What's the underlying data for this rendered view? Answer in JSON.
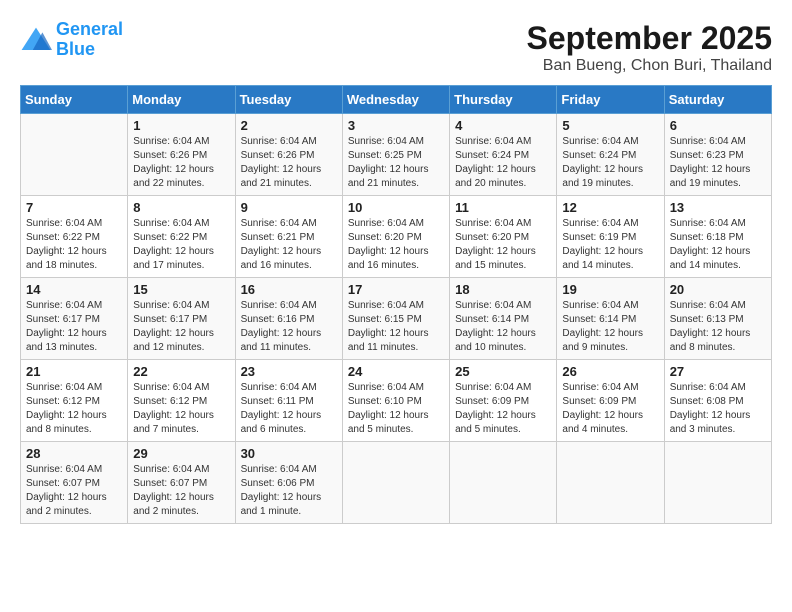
{
  "header": {
    "logo_line1": "General",
    "logo_line2": "Blue",
    "month": "September 2025",
    "location": "Ban Bueng, Chon Buri, Thailand"
  },
  "days_of_week": [
    "Sunday",
    "Monday",
    "Tuesday",
    "Wednesday",
    "Thursday",
    "Friday",
    "Saturday"
  ],
  "weeks": [
    [
      {
        "day": "",
        "info": ""
      },
      {
        "day": "1",
        "info": "Sunrise: 6:04 AM\nSunset: 6:26 PM\nDaylight: 12 hours\nand 22 minutes."
      },
      {
        "day": "2",
        "info": "Sunrise: 6:04 AM\nSunset: 6:26 PM\nDaylight: 12 hours\nand 21 minutes."
      },
      {
        "day": "3",
        "info": "Sunrise: 6:04 AM\nSunset: 6:25 PM\nDaylight: 12 hours\nand 21 minutes."
      },
      {
        "day": "4",
        "info": "Sunrise: 6:04 AM\nSunset: 6:24 PM\nDaylight: 12 hours\nand 20 minutes."
      },
      {
        "day": "5",
        "info": "Sunrise: 6:04 AM\nSunset: 6:24 PM\nDaylight: 12 hours\nand 19 minutes."
      },
      {
        "day": "6",
        "info": "Sunrise: 6:04 AM\nSunset: 6:23 PM\nDaylight: 12 hours\nand 19 minutes."
      }
    ],
    [
      {
        "day": "7",
        "info": "Sunrise: 6:04 AM\nSunset: 6:22 PM\nDaylight: 12 hours\nand 18 minutes."
      },
      {
        "day": "8",
        "info": "Sunrise: 6:04 AM\nSunset: 6:22 PM\nDaylight: 12 hours\nand 17 minutes."
      },
      {
        "day": "9",
        "info": "Sunrise: 6:04 AM\nSunset: 6:21 PM\nDaylight: 12 hours\nand 16 minutes."
      },
      {
        "day": "10",
        "info": "Sunrise: 6:04 AM\nSunset: 6:20 PM\nDaylight: 12 hours\nand 16 minutes."
      },
      {
        "day": "11",
        "info": "Sunrise: 6:04 AM\nSunset: 6:20 PM\nDaylight: 12 hours\nand 15 minutes."
      },
      {
        "day": "12",
        "info": "Sunrise: 6:04 AM\nSunset: 6:19 PM\nDaylight: 12 hours\nand 14 minutes."
      },
      {
        "day": "13",
        "info": "Sunrise: 6:04 AM\nSunset: 6:18 PM\nDaylight: 12 hours\nand 14 minutes."
      }
    ],
    [
      {
        "day": "14",
        "info": "Sunrise: 6:04 AM\nSunset: 6:17 PM\nDaylight: 12 hours\nand 13 minutes."
      },
      {
        "day": "15",
        "info": "Sunrise: 6:04 AM\nSunset: 6:17 PM\nDaylight: 12 hours\nand 12 minutes."
      },
      {
        "day": "16",
        "info": "Sunrise: 6:04 AM\nSunset: 6:16 PM\nDaylight: 12 hours\nand 11 minutes."
      },
      {
        "day": "17",
        "info": "Sunrise: 6:04 AM\nSunset: 6:15 PM\nDaylight: 12 hours\nand 11 minutes."
      },
      {
        "day": "18",
        "info": "Sunrise: 6:04 AM\nSunset: 6:14 PM\nDaylight: 12 hours\nand 10 minutes."
      },
      {
        "day": "19",
        "info": "Sunrise: 6:04 AM\nSunset: 6:14 PM\nDaylight: 12 hours\nand 9 minutes."
      },
      {
        "day": "20",
        "info": "Sunrise: 6:04 AM\nSunset: 6:13 PM\nDaylight: 12 hours\nand 8 minutes."
      }
    ],
    [
      {
        "day": "21",
        "info": "Sunrise: 6:04 AM\nSunset: 6:12 PM\nDaylight: 12 hours\nand 8 minutes."
      },
      {
        "day": "22",
        "info": "Sunrise: 6:04 AM\nSunset: 6:12 PM\nDaylight: 12 hours\nand 7 minutes."
      },
      {
        "day": "23",
        "info": "Sunrise: 6:04 AM\nSunset: 6:11 PM\nDaylight: 12 hours\nand 6 minutes."
      },
      {
        "day": "24",
        "info": "Sunrise: 6:04 AM\nSunset: 6:10 PM\nDaylight: 12 hours\nand 5 minutes."
      },
      {
        "day": "25",
        "info": "Sunrise: 6:04 AM\nSunset: 6:09 PM\nDaylight: 12 hours\nand 5 minutes."
      },
      {
        "day": "26",
        "info": "Sunrise: 6:04 AM\nSunset: 6:09 PM\nDaylight: 12 hours\nand 4 minutes."
      },
      {
        "day": "27",
        "info": "Sunrise: 6:04 AM\nSunset: 6:08 PM\nDaylight: 12 hours\nand 3 minutes."
      }
    ],
    [
      {
        "day": "28",
        "info": "Sunrise: 6:04 AM\nSunset: 6:07 PM\nDaylight: 12 hours\nand 2 minutes."
      },
      {
        "day": "29",
        "info": "Sunrise: 6:04 AM\nSunset: 6:07 PM\nDaylight: 12 hours\nand 2 minutes."
      },
      {
        "day": "30",
        "info": "Sunrise: 6:04 AM\nSunset: 6:06 PM\nDaylight: 12 hours\nand 1 minute."
      },
      {
        "day": "",
        "info": ""
      },
      {
        "day": "",
        "info": ""
      },
      {
        "day": "",
        "info": ""
      },
      {
        "day": "",
        "info": ""
      }
    ]
  ]
}
